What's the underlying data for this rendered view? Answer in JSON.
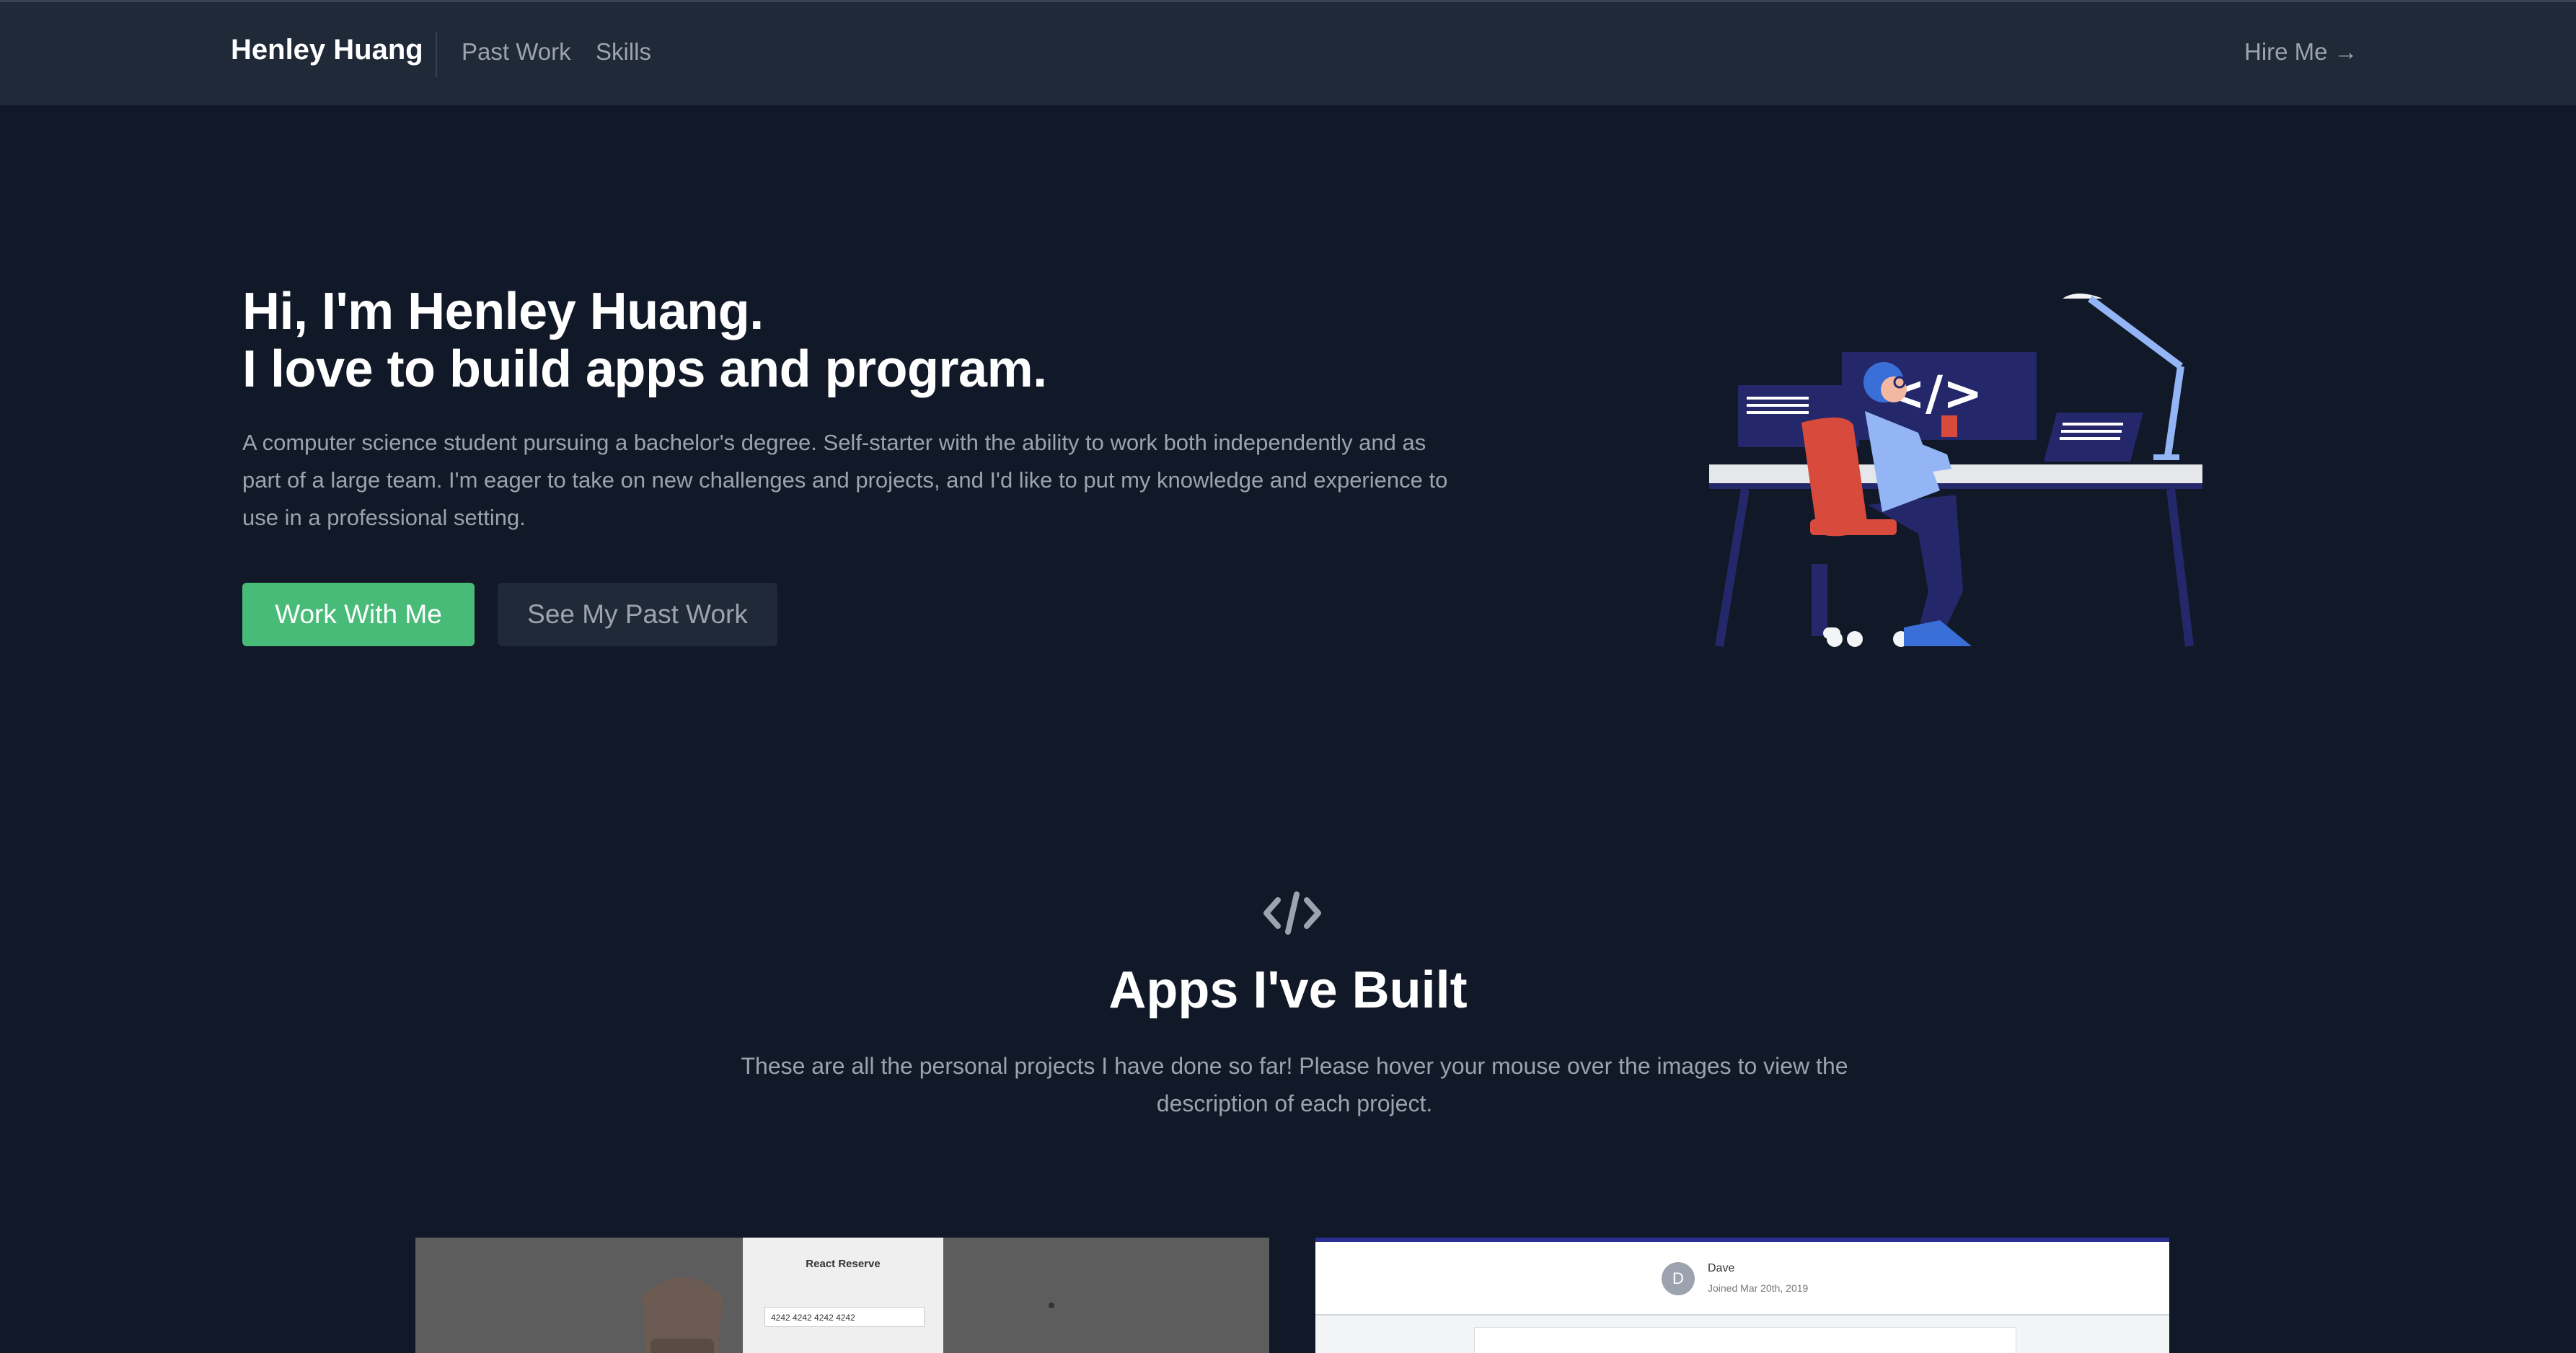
{
  "nav": {
    "brand": "Henley Huang",
    "links": [
      "Past Work",
      "Skills"
    ],
    "hire": "Hire Me →"
  },
  "hero": {
    "title_line1": "Hi, I'm Henley Huang.",
    "title_line2": "I love to build apps and program.",
    "paragraph": "A computer science student pursuing a bachelor's degree. Self-starter with the ability to work both independently and as part of a large team. I'm eager to take on new challenges and projects, and I'd like to put my knowledge and experience to use in a professional setting.",
    "primary_button": "Work With Me",
    "secondary_button": "See My Past Work",
    "illustration_code_glyph": "</>"
  },
  "section": {
    "icon": "</>",
    "title": "Apps I've Built",
    "paragraph": "These are all the personal projects I have done so far! Please hover your mouse over the images to view the description of each project."
  },
  "projects": [
    {
      "panel_title": "React Reserve",
      "card_number": "4242 4242 4242 4242"
    },
    {
      "user": "Dave",
      "user_initial": "D",
      "joined": "Joined Mar 20th, 2019"
    }
  ],
  "colors": {
    "background": "#111827",
    "nav_bg": "#1f2937",
    "accent_green": "#48bb78",
    "text_muted": "#9ca3af"
  }
}
